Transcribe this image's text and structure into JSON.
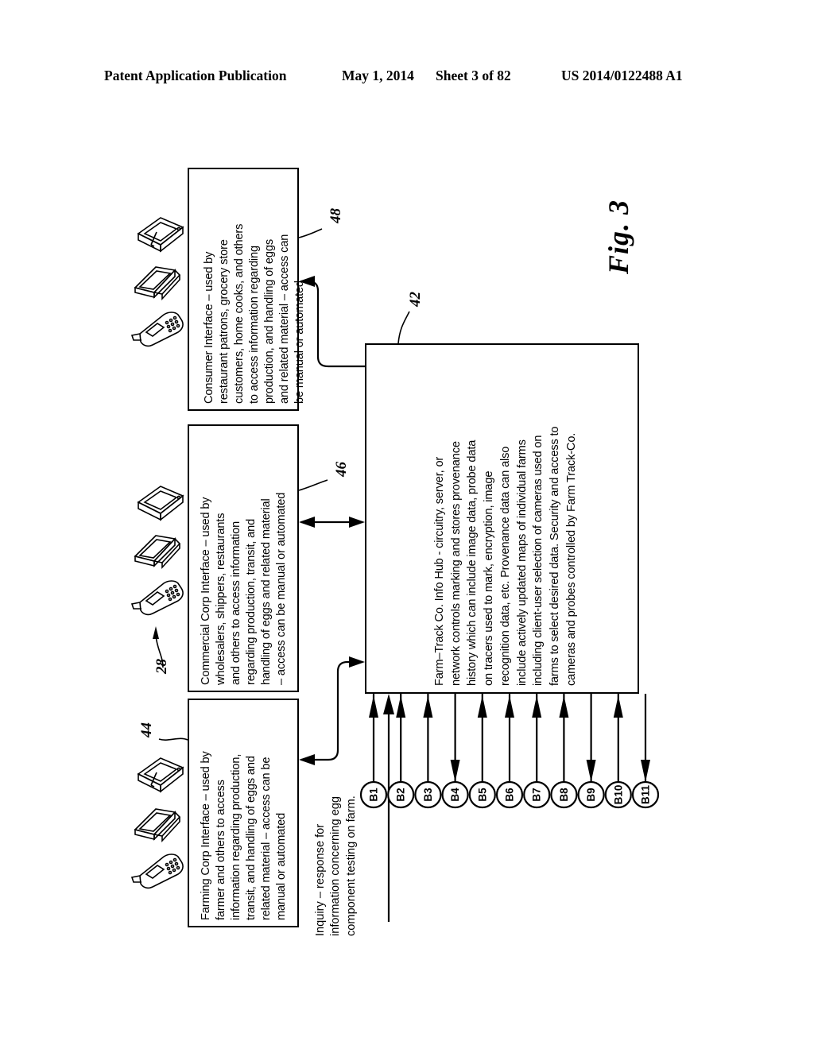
{
  "header": {
    "publication": "Patent Application Publication",
    "date": "May 1, 2014",
    "sheet": "Sheet 3 of 82",
    "patent_number": "US 2014/0122488 A1"
  },
  "figure": {
    "caption": "Fig. 3",
    "boxes": {
      "consumer": {
        "ref": "48",
        "text": "Consumer Interface – used by\nrestaurant patrons, grocery store\ncustomers, home cooks, and others\nto access information regarding\nproduction, and handling of eggs\nand related material – access can\nbe manual or automated"
      },
      "commercial": {
        "ref": "46",
        "text": "Commercial Corp Interface – used by\nwholesalers, shippers, restaurants\nand others to access information\nregarding production, transit, and\nhandling of eggs and related material\n– access can be manual or automated"
      },
      "farming": {
        "ref": "44",
        "text": "Farming Corp Interface – used by\nfarmer and others to access\ninformation regarding production,\ntransit, and handling of eggs and\nrelated material – access can be\nmanual or automated"
      },
      "hub": {
        "ref": "42",
        "text": "Farm–Track Co. Info Hub - circuitry, server, or\nnetwork controls marking and stores provenance\nhistory which can include image data, probe data\non tracers used to mark, encryption, image\nrecognition  data, etc. Provenance data can also\ninclude actively updated maps of individual farms\nincluding client-user selection of cameras used on\nfarms to select desired data.  Security and access to\ncameras and probes controlled by Farm Track-Co."
      }
    },
    "inquiry": {
      "text": "Inquiry – response for\ninformation concerning egg\ncomponent testing on farm."
    },
    "device_group_ref": "28",
    "device_icons": [
      "tablet-stylus-icon",
      "laptop-icon",
      "mobile-phone-icon"
    ],
    "terminals": [
      {
        "label": "B1",
        "direction": "up"
      },
      {
        "label": "B2",
        "direction": "up"
      },
      {
        "label": "B3",
        "direction": "up"
      },
      {
        "label": "B4",
        "direction": "down"
      },
      {
        "label": "B5",
        "direction": "up"
      },
      {
        "label": "B6",
        "direction": "up"
      },
      {
        "label": "B7",
        "direction": "up"
      },
      {
        "label": "B8",
        "direction": "up"
      },
      {
        "label": "B9",
        "direction": "down"
      },
      {
        "label": "B10",
        "direction": "up"
      },
      {
        "label": "B11",
        "direction": "down"
      }
    ]
  }
}
